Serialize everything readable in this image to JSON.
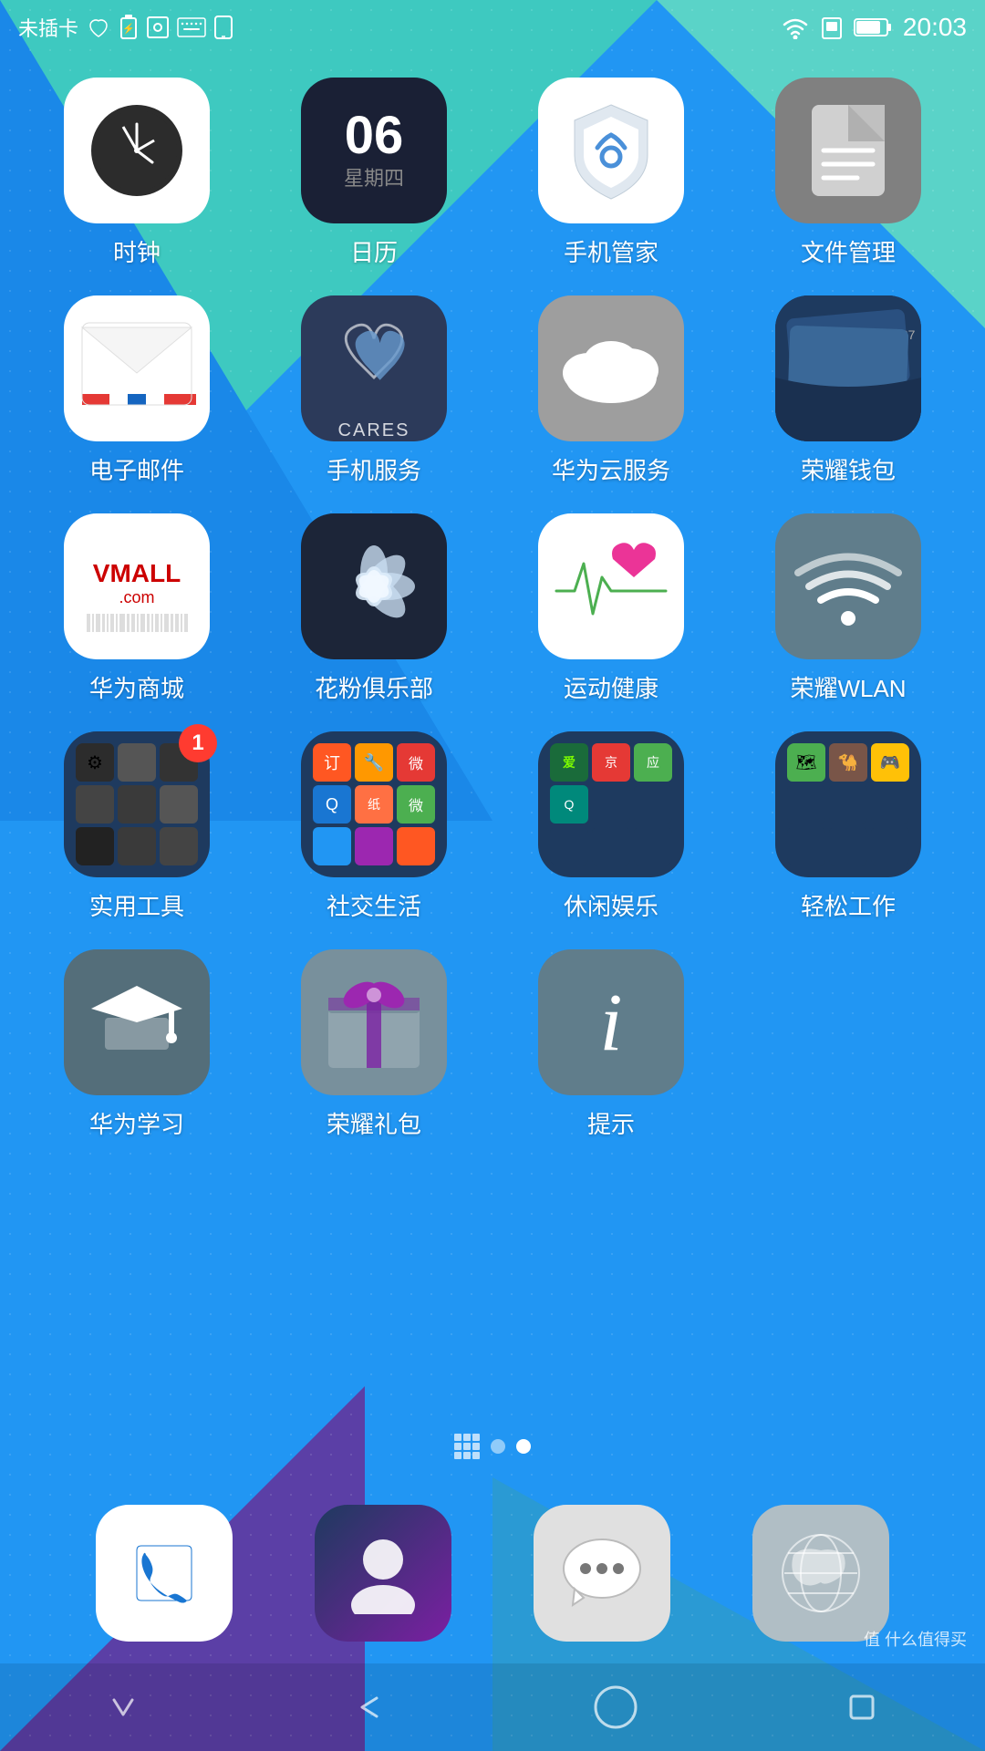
{
  "statusBar": {
    "carrier": "未插卡",
    "time": "20:03",
    "icons": [
      "sim",
      "wifi",
      "battery"
    ]
  },
  "background": {
    "topTeal": "#3ec9c0",
    "mainBlue": "#2196f3",
    "purple": "#5b3fa6"
  },
  "apps": [
    {
      "id": "clock",
      "label": "时钟",
      "type": "clock"
    },
    {
      "id": "calendar",
      "label": "日历",
      "type": "calendar",
      "date": "06",
      "day": "星期四"
    },
    {
      "id": "phonemanager",
      "label": "手机管家",
      "type": "shield"
    },
    {
      "id": "filemanager",
      "label": "文件管理",
      "type": "file"
    },
    {
      "id": "email",
      "label": "电子邮件",
      "type": "email"
    },
    {
      "id": "phoneservice",
      "label": "手机服务",
      "type": "cares",
      "cares": "CARES"
    },
    {
      "id": "cloudservice",
      "label": "华为云服务",
      "type": "cloud"
    },
    {
      "id": "wallet",
      "label": "荣耀钱包",
      "type": "wallet"
    },
    {
      "id": "vmall",
      "label": "华为商城",
      "type": "vmall",
      "text": "VMALL"
    },
    {
      "id": "huafenclub",
      "label": "花粉俱乐部",
      "type": "flower"
    },
    {
      "id": "health",
      "label": "运动健康",
      "type": "health"
    },
    {
      "id": "wlan",
      "label": "荣耀WLAN",
      "type": "wifi"
    },
    {
      "id": "tools",
      "label": "实用工具",
      "type": "folder-tools",
      "badge": "1"
    },
    {
      "id": "social",
      "label": "社交生活",
      "type": "folder-social"
    },
    {
      "id": "entertainment",
      "label": "休闲娱乐",
      "type": "folder-entertainment"
    },
    {
      "id": "work",
      "label": "轻松工作",
      "type": "folder-work"
    },
    {
      "id": "education",
      "label": "华为学习",
      "type": "education"
    },
    {
      "id": "gift",
      "label": "荣耀礼包",
      "type": "gift"
    },
    {
      "id": "tips",
      "label": "提示",
      "type": "tips"
    }
  ],
  "dock": [
    {
      "id": "phone",
      "type": "phone"
    },
    {
      "id": "contacts",
      "type": "contacts"
    },
    {
      "id": "messages",
      "type": "messages"
    },
    {
      "id": "browser",
      "type": "browser"
    }
  ],
  "pageIndicators": [
    "grid",
    "dot",
    "dot-active"
  ],
  "navBar": {
    "buttons": [
      "down",
      "back",
      "home",
      "recent"
    ]
  },
  "watermark": "值 什么值得买"
}
